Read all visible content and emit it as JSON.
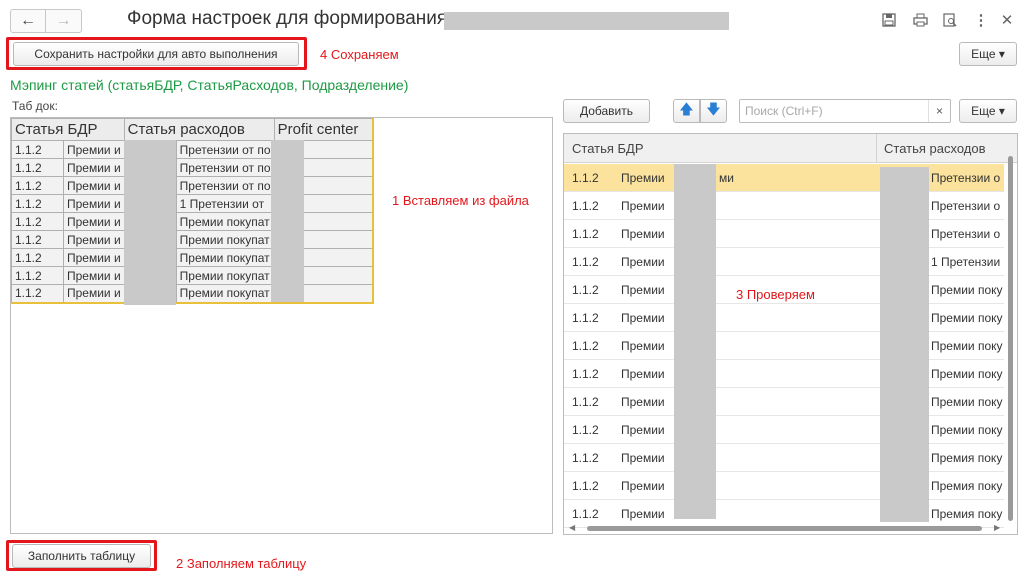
{
  "window": {
    "title": "Форма настроек для формирования",
    "nav_back": "←",
    "nav_forward": "→",
    "icons": [
      "save-icon",
      "print-icon",
      "preview-icon",
      "more-vertical-icon",
      "close-icon"
    ]
  },
  "toolbar": {
    "save_settings_label": "Сохранить настройки для авто выполнения",
    "more_label": "Еще ▾"
  },
  "annotations": {
    "step4": "4 Сохраняем",
    "step1": "1  Вставляем из файла",
    "step3": "3 Проверяем",
    "step2": "2  Заполняем таблицу"
  },
  "mapping": {
    "title": "Мэпинг статей (статьяБДР, СтатьяРасходов, Подразделение)",
    "tabdoc_label": "Таб док:",
    "columns": [
      "Статья БДР",
      "Статья расходов",
      "Profit center"
    ],
    "rows": [
      {
        "code": "1.1.2",
        "name": "Премии и",
        "expense": "Претензии от по"
      },
      {
        "code": "1.1.2",
        "name": "Премии и",
        "expense": "Претензии от по"
      },
      {
        "code": "1.1.2",
        "name": "Премии и",
        "expense": "Претензии от по"
      },
      {
        "code": "1.1.2",
        "name": "Премии и",
        "expense": "1 Претензии от"
      },
      {
        "code": "1.1.2",
        "name": "Премии и",
        "expense": "Премии покупат"
      },
      {
        "code": "1.1.2",
        "name": "Премии и",
        "expense": "Премии покупат"
      },
      {
        "code": "1.1.2",
        "name": "Премии и",
        "expense": "Премии покупат"
      },
      {
        "code": "1.1.2",
        "name": "Премии и",
        "expense": "Премии покупат"
      },
      {
        "code": "1.1.2",
        "name": "Премии и",
        "expense": "Премии покупат"
      }
    ]
  },
  "right_panel": {
    "add_label": "Добавить",
    "up_arrow": "🡅",
    "down_arrow": "🡇",
    "search_placeholder": "Поиск (Ctrl+F)",
    "search_clear": "×",
    "more_label": "Еще ▾",
    "columns": [
      "Статья БДР",
      "Статья расходов"
    ],
    "rows": [
      {
        "code": "1.1.2",
        "name": "Премии",
        "tail": "ми",
        "expense": "Претензии о",
        "selected": true
      },
      {
        "code": "1.1.2",
        "name": "Премии",
        "tail": "",
        "expense": "Претензии о"
      },
      {
        "code": "1.1.2",
        "name": "Премии",
        "tail": "",
        "expense": "Претензии о"
      },
      {
        "code": "1.1.2",
        "name": "Премии",
        "tail": "",
        "expense": "1 Претензии"
      },
      {
        "code": "1.1.2",
        "name": "Премии",
        "tail": "",
        "expense": "Премии поку"
      },
      {
        "code": "1.1.2",
        "name": "Премии",
        "tail": "",
        "expense": "Премии поку"
      },
      {
        "code": "1.1.2",
        "name": "Премии",
        "tail": "",
        "expense": "Премии поку"
      },
      {
        "code": "1.1.2",
        "name": "Премии",
        "tail": "",
        "expense": "Премии поку"
      },
      {
        "code": "1.1.2",
        "name": "Премии",
        "tail": "",
        "expense": "Премии поку"
      },
      {
        "code": "1.1.2",
        "name": "Премии",
        "tail": "",
        "expense": "Премии поку"
      },
      {
        "code": "1.1.2",
        "name": "Премии",
        "tail": "",
        "expense": "Премия поку"
      },
      {
        "code": "1.1.2",
        "name": "Премии",
        "tail": "",
        "expense": "Премия поку"
      },
      {
        "code": "1.1.2",
        "name": "Премии",
        "tail": "",
        "expense": "Премия поку"
      }
    ]
  },
  "footer": {
    "fill_table_label": "Заполнить таблицу"
  },
  "colors": {
    "accent_green": "#1d9a44",
    "annotation_red": "#e3171b",
    "selected_row": "#fbe39d",
    "active_border": "#e7c13a"
  }
}
